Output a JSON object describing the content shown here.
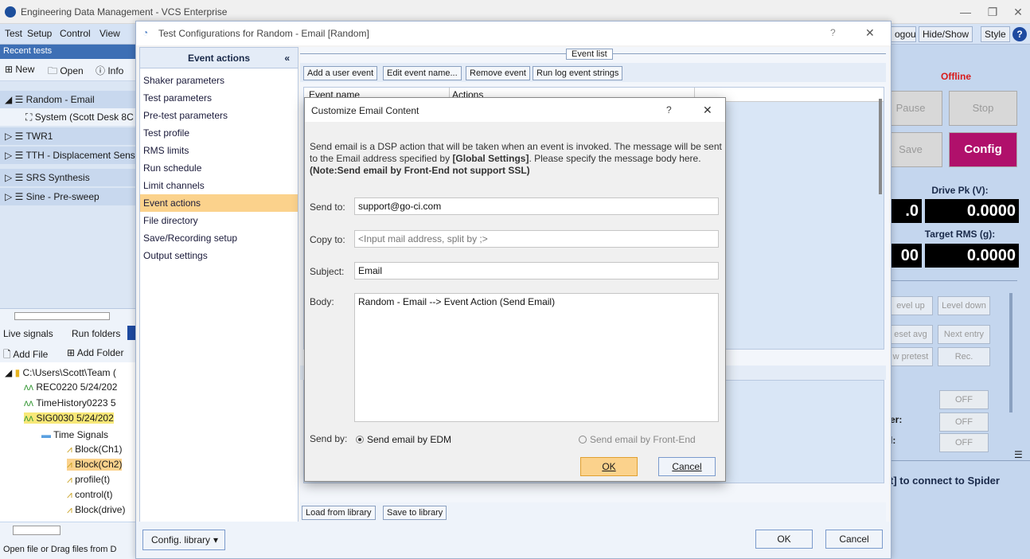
{
  "app": {
    "title": "Engineering Data Management - VCS Enterprise"
  },
  "menu": [
    "Test",
    "Setup",
    "Control",
    "View"
  ],
  "top_buttons": {
    "logout": "ogout",
    "hide_show": "Hide/Show",
    "style": "Style"
  },
  "left": {
    "recent_header": "Recent tests",
    "toolbar": {
      "new": "New",
      "open": "Open",
      "info": "Info"
    },
    "tests": [
      {
        "name": "Random - Email",
        "selected": true
      },
      {
        "name": "System (Scott Desk 8C",
        "child": true
      },
      {
        "name": "TWR1"
      },
      {
        "name": "TTH - Displacement Sens"
      },
      {
        "name": "SRS Synthesis"
      },
      {
        "name": "Sine - Pre-sweep"
      }
    ],
    "tabs": {
      "live_signals": "Live signals",
      "run_folders": "Run folders"
    },
    "toolbar2": {
      "add_file": "Add File",
      "add_folder": "Add Folder"
    },
    "files": [
      {
        "label": "C:\\Users\\Scott\\Team (",
        "level": 0
      },
      {
        "label": "REC0220 5/24/202",
        "level": 1
      },
      {
        "label": "TimeHistory0223 5",
        "level": 1
      },
      {
        "label": "SIG0030 5/24/202",
        "level": 1,
        "highlight": true
      },
      {
        "label": "Time Signals",
        "level": 2
      },
      {
        "label": "Block(Ch1)",
        "level": 3
      },
      {
        "label": "Block(Ch2)",
        "level": 3,
        "highlight": true
      },
      {
        "label": "profile(t)",
        "level": 3
      },
      {
        "label": "control(t)",
        "level": 3
      },
      {
        "label": "Block(drive)",
        "level": 3
      }
    ],
    "status": "Open file or Drag files from D"
  },
  "right": {
    "offline": "Offline",
    "pause": "Pause",
    "stop": "Stop",
    "save": "Save",
    "config": "Config",
    "drive_pk_label": "Drive Pk (V):",
    "drive_left": ".0",
    "drive_value": "0.0000",
    "target_rms_label": "Target RMS (g):",
    "target_left": "00",
    "target_value": "0.0000",
    "level_up": "evel up",
    "level_down": "Level down",
    "reset_avg": "eset avg",
    "next_entry": "Next entry",
    "view_pretest": "w pretest",
    "rec": "Rec.",
    "off": "OFF",
    "er_label": "er:",
    "l_label": "l:",
    "connect": "t] to connect to Spider"
  },
  "config_dialog": {
    "title": "Test Configurations for Random - Email [Random]",
    "nav_header": "Event actions",
    "nav_items": [
      "Shaker parameters",
      "Test parameters",
      "Pre-test parameters",
      "Test profile",
      "RMS limits",
      "Run schedule",
      "Limit channels",
      "Event actions",
      "File directory",
      "Save/Recording setup",
      "Output settings"
    ],
    "event_list_label": "Event list",
    "event_buttons": {
      "add": "Add a user event",
      "edit": "Edit event name...",
      "remove": "Remove event",
      "runlog": "Run log event strings"
    },
    "columns": {
      "name": "Event name",
      "actions": "Actions"
    },
    "load_library": "Load from library",
    "save_library": "Save to library",
    "config_library": "Config. library",
    "ok": "OK",
    "cancel": "Cancel"
  },
  "email_dialog": {
    "title": "Customize Email Content",
    "description_1": "Send email is a DSP action that will be taken when an event is invoked. The message will be sent to the Email address specified by ",
    "description_bold": "[Global Settings]",
    "description_2": ". Please specify the message body here.",
    "note": "(Note:Send email by Front-End not support SSL)",
    "send_to_label": "Send to:",
    "send_to_value": "support@go-ci.com",
    "copy_to_label": "Copy to:",
    "copy_to_placeholder": "<Input mail address, split by ;>",
    "subject_label": "Subject:",
    "subject_value": "Email",
    "body_label": "Body:",
    "body_value": "Random - Email --> Event Action (Send Email)",
    "send_by_label": "Send by:",
    "send_by_edm": "Send email by EDM",
    "send_by_frontend": "Send email by Front-End",
    "ok": "OK",
    "cancel": "Cancel"
  },
  "colors": {
    "accent_pink": "#b0106b",
    "highlight_orange": "#fbd28c",
    "offline_red": "#d81b1b"
  }
}
